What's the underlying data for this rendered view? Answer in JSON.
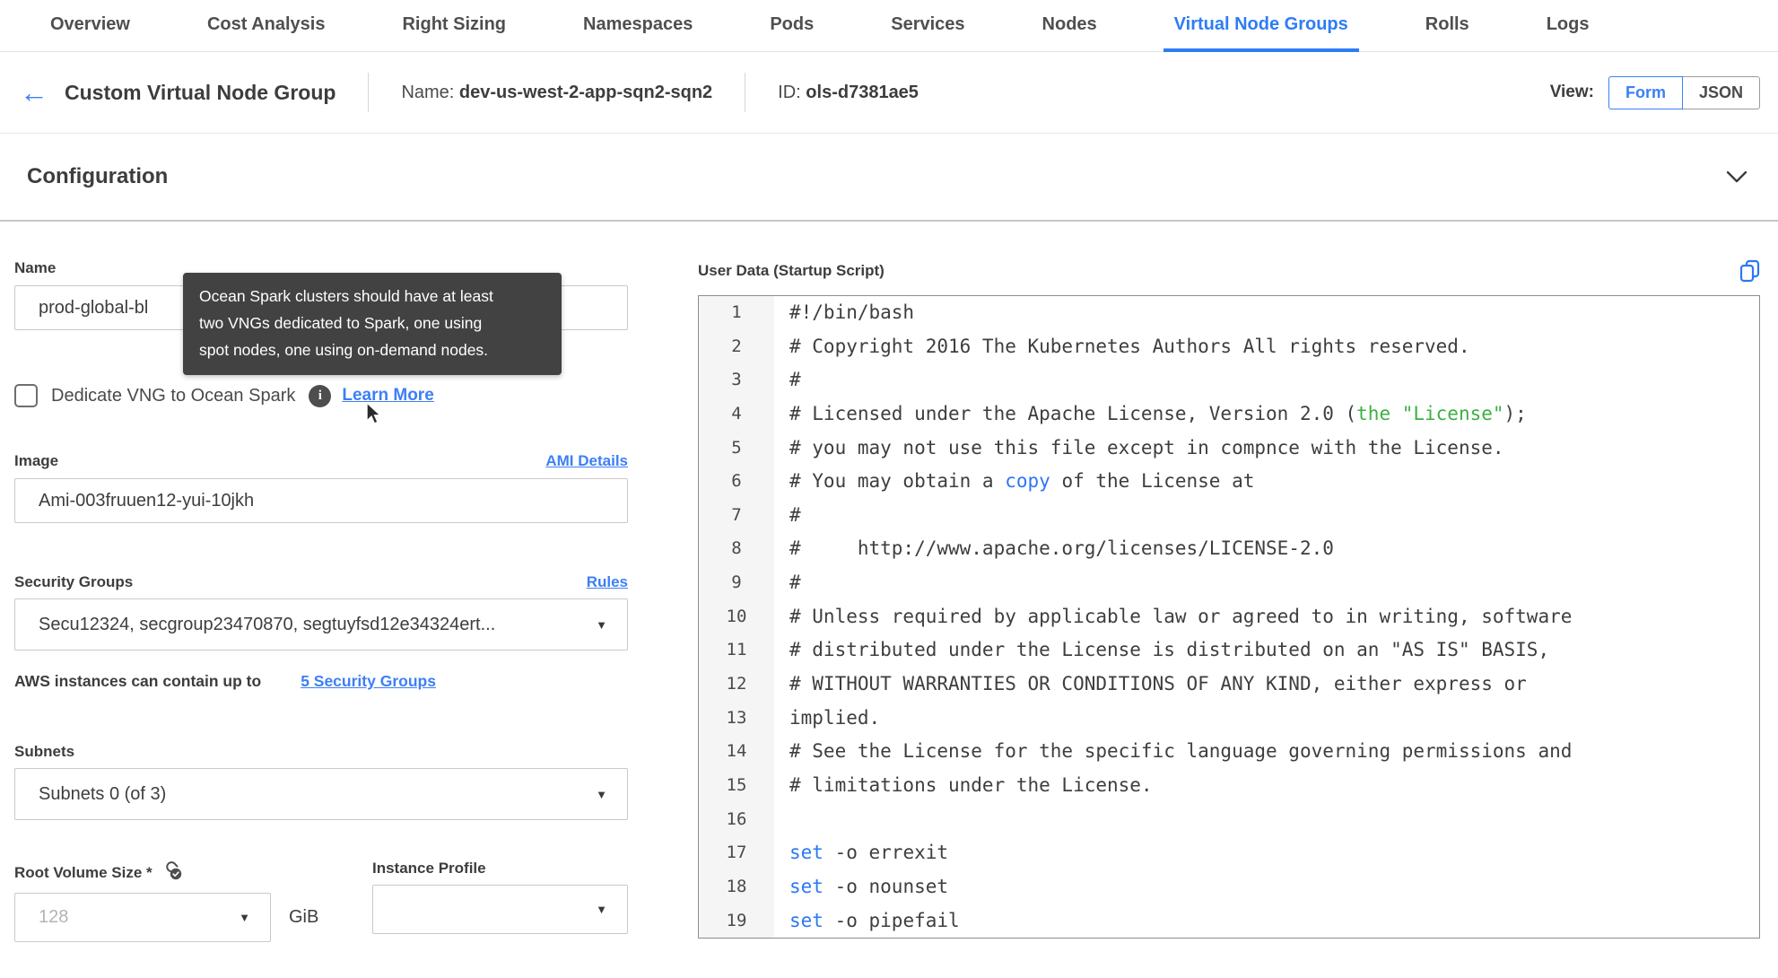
{
  "colors": {
    "accent": "#3d7ff5",
    "tooltip_bg": "#424242",
    "code_green": "#3cb043",
    "code_blue": "#2c77f4",
    "active_tab": "#2e7cf5"
  },
  "icons": {
    "back": "←",
    "caret": "▼",
    "info": "i"
  },
  "tabs": {
    "items": [
      {
        "label": "Overview",
        "active": false
      },
      {
        "label": "Cost Analysis",
        "active": false
      },
      {
        "label": "Right Sizing",
        "active": false
      },
      {
        "label": "Namespaces",
        "active": false
      },
      {
        "label": "Pods",
        "active": false
      },
      {
        "label": "Services",
        "active": false
      },
      {
        "label": "Nodes",
        "active": false
      },
      {
        "label": "Virtual Node Groups",
        "active": true
      },
      {
        "label": "Rolls",
        "active": false
      },
      {
        "label": "Logs",
        "active": false
      }
    ]
  },
  "header": {
    "title": "Custom Virtual Node Group",
    "name_label": "Name:",
    "name_value": "dev-us-west-2-app-sqn2-sqn2",
    "id_label": "ID:",
    "id_value": "ols-d7381ae5",
    "view_label": "View:",
    "view_options": [
      "Form",
      "JSON"
    ],
    "active_view": "Form"
  },
  "section": {
    "title": "Configuration"
  },
  "form": {
    "name": {
      "label": "Name",
      "value": "prod-global-bl"
    },
    "tooltip": {
      "lines": [
        "Ocean Spark clusters should have at least",
        "two VNGs dedicated to Spark, one using",
        "spot nodes, one using on-demand nodes."
      ]
    },
    "dedicate": {
      "label": "Dedicate VNG to Ocean Spark",
      "checked": false,
      "learn_more": "Learn More"
    },
    "image": {
      "label": "Image",
      "link": "AMI Details",
      "value": "Ami-003fruuen12-yui-10jkh"
    },
    "security_groups": {
      "label": "Security Groups",
      "link": "Rules",
      "value": "Secu12324, secgroup23470870, segtuyfsd12e34324ert...",
      "hint_text": "AWS instances can contain up to",
      "hint_link": "5 Security Groups"
    },
    "subnets": {
      "label": "Subnets",
      "value": "Subnets 0 (of 3)"
    },
    "root_volume": {
      "label": "Root Volume Size *",
      "placeholder": "128",
      "unit": "GiB"
    },
    "instance_profile": {
      "label": "Instance Profile",
      "value": ""
    }
  },
  "editor": {
    "title": "User Data (Startup Script)",
    "lines": [
      [
        {
          "t": "#!/bin/bash",
          "c": "d"
        }
      ],
      [
        {
          "t": "# Copyright 2016 The Kubernetes Authors All rights reserved.",
          "c": "d"
        }
      ],
      [
        {
          "t": "#",
          "c": "d"
        }
      ],
      [
        {
          "t": "# Licensed under the Apache License, Version 2.0 (",
          "c": "d"
        },
        {
          "t": "the \"License\"",
          "c": "g"
        },
        {
          "t": ");",
          "c": "d"
        }
      ],
      [
        {
          "t": "# you may not use this file except in compnce with the License.",
          "c": "d"
        }
      ],
      [
        {
          "t": "# You may obtain a ",
          "c": "d"
        },
        {
          "t": "copy",
          "c": "b"
        },
        {
          "t": " of the License at",
          "c": "d"
        }
      ],
      [
        {
          "t": "#",
          "c": "d"
        }
      ],
      [
        {
          "t": "#     http://www.apache.org/licenses/LICENSE-2.0",
          "c": "d"
        }
      ],
      [
        {
          "t": "#",
          "c": "d"
        }
      ],
      [
        {
          "t": "# Unless required by applicable law or agreed to in writing, software",
          "c": "d"
        }
      ],
      [
        {
          "t": "# distributed under the License is distributed on an \"AS IS\" BASIS,",
          "c": "d"
        }
      ],
      [
        {
          "t": "# WITHOUT WARRANTIES OR CONDITIONS OF ANY KIND, either express or",
          "c": "d"
        }
      ],
      [
        {
          "t": "implied.",
          "c": "d"
        }
      ],
      [
        {
          "t": "# See the License for the specific language governing permissions and",
          "c": "d"
        }
      ],
      [
        {
          "t": "# limitations under the License.",
          "c": "d"
        }
      ],
      [
        {
          "t": "",
          "c": "d"
        }
      ],
      [
        {
          "t": "set",
          "c": "b"
        },
        {
          "t": " -o errexit",
          "c": "d"
        }
      ],
      [
        {
          "t": "set",
          "c": "b"
        },
        {
          "t": " -o nounset",
          "c": "d"
        }
      ],
      [
        {
          "t": "set",
          "c": "b"
        },
        {
          "t": " -o pipefail",
          "c": "d"
        }
      ]
    ]
  }
}
